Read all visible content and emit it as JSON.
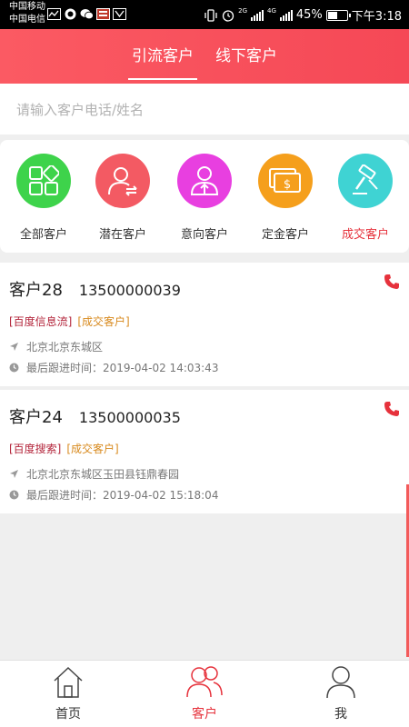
{
  "status_bar": {
    "carrier1": "中国移动",
    "carrier2": "中国电信",
    "network1": "2G",
    "network2": "4G",
    "battery": "45%",
    "battery_level": 0.45,
    "time": "下午3:18"
  },
  "header": {
    "tabs": [
      {
        "label": "引流客户",
        "active": true
      },
      {
        "label": "线下客户",
        "active": false
      }
    ]
  },
  "search": {
    "placeholder": "请输入客户电话/姓名"
  },
  "categories": [
    {
      "label": "全部客户",
      "icon": "grid-icon",
      "color": "#3ed34b"
    },
    {
      "label": "潜在客户",
      "icon": "user-transfer-icon",
      "color": "#f35a63"
    },
    {
      "label": "意向客户",
      "icon": "user-arrow-icon",
      "color": "#e83fe0"
    },
    {
      "label": "定金客户",
      "icon": "money-cash-icon",
      "color": "#f59f1c"
    },
    {
      "label": "成交客户",
      "icon": "gavel-icon",
      "color": "#3fd3d3",
      "selected": true
    }
  ],
  "customers": [
    {
      "name": "客户28",
      "phone": "13500000039",
      "source_tag": "[百度信息流]",
      "status_tag": "[成交客户]",
      "location": "北京北京东城区",
      "last_follow": "最后跟进时间：2019-04-02 14:03:43"
    },
    {
      "name": "客户24",
      "phone": "13500000035",
      "source_tag": "[百度搜索]",
      "status_tag": "[成交客户]",
      "location": "北京北京东城区玉田县钰鼎春园",
      "last_follow": "最后跟进时间：2019-04-02 15:18:04"
    }
  ],
  "bottom_nav": [
    {
      "label": "首页",
      "icon": "home-icon",
      "active": false
    },
    {
      "label": "客户",
      "icon": "customers-icon",
      "active": true
    },
    {
      "label": "我",
      "icon": "profile-icon",
      "active": false
    }
  ],
  "colors": {
    "brand": "#f54856",
    "accent_red": "#e6323c",
    "tag_source": "#b3243a",
    "tag_status": "#d88a1e"
  }
}
